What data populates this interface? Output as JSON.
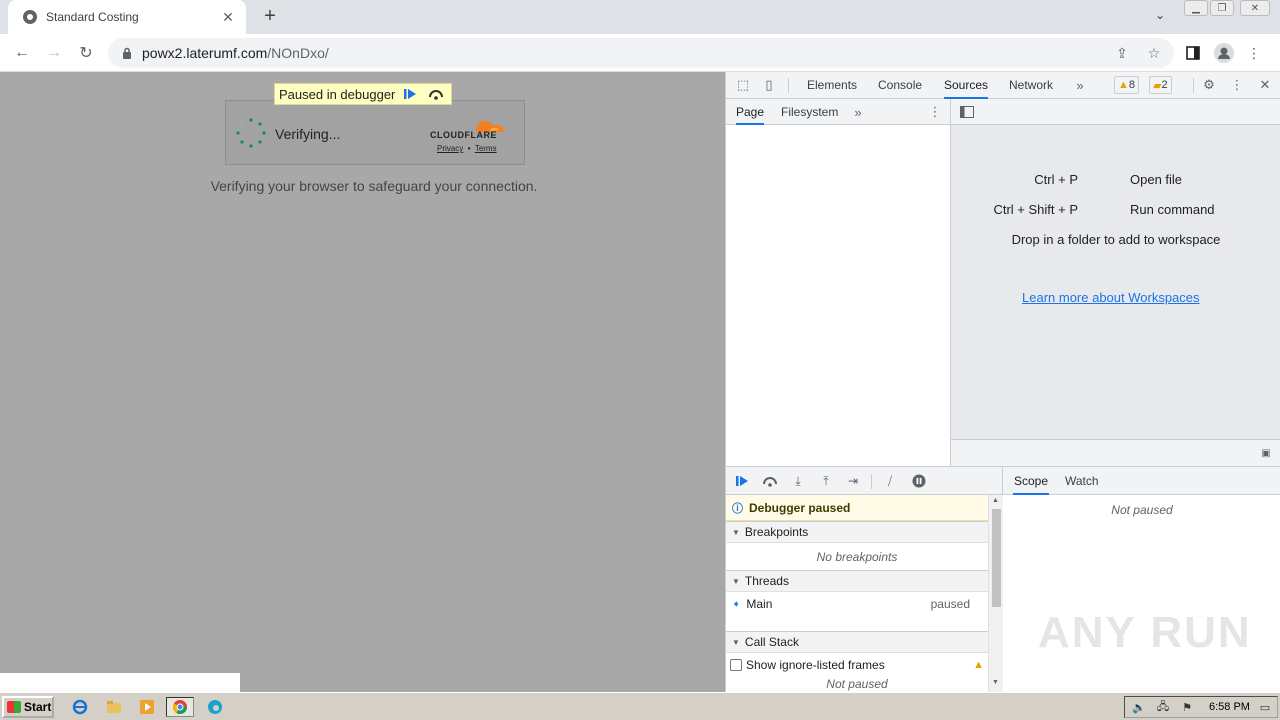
{
  "browser": {
    "tab_title": "Standard Costing",
    "url_host": "powx2.laterumf.com",
    "url_path": "/NOnDxo/"
  },
  "page": {
    "debugger_banner": "Paused in debugger",
    "cf_status": "Verifying...",
    "cf_brand": "CLOUDFLARE",
    "cf_privacy": "Privacy",
    "cf_dot": "•",
    "cf_terms": "Terms",
    "verify_message": "Verifying your browser to safeguard your connection."
  },
  "devtools": {
    "tabs": [
      "Elements",
      "Console",
      "Sources",
      "Network"
    ],
    "active_tab": "Sources",
    "warning_count": "8",
    "issue_count": "2",
    "navigator_tabs": [
      "Page",
      "Filesystem"
    ],
    "shortcuts": [
      {
        "key": "Ctrl + P",
        "action": "Open file"
      },
      {
        "key": "Ctrl + Shift + P",
        "action": "Run command"
      }
    ],
    "workspace_hint": "Drop in a folder to add to workspace",
    "workspace_link": "Learn more about Workspaces",
    "debugger_paused": "Debugger paused",
    "breakpoints_label": "Breakpoints",
    "no_breakpoints": "No breakpoints",
    "threads_label": "Threads",
    "thread_name": "Main",
    "thread_status": "paused",
    "callstack_label": "Call Stack",
    "ignore_frames_label": "Show ignore-listed frames",
    "not_paused": "Not paused",
    "scope_tabs": [
      "Scope",
      "Watch"
    ],
    "scope_not_paused": "Not paused"
  },
  "taskbar": {
    "start_label": "Start",
    "clock": "6:58 PM"
  },
  "watermark": "ANY RUN",
  "colors": {
    "accent": "#1a73e8",
    "viewport_bg": "#a8a8a8",
    "banner_bg": "#ffffc2",
    "cf_orange": "#f38020"
  }
}
